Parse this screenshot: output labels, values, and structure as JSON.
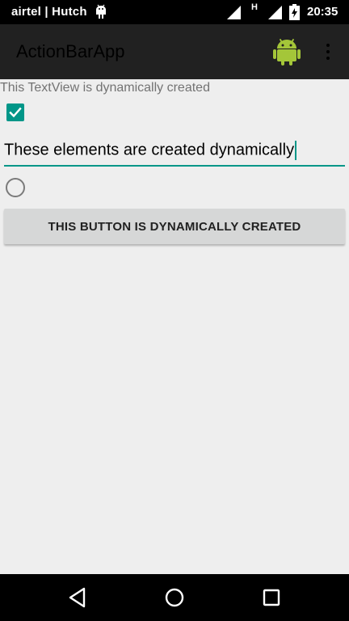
{
  "status_bar": {
    "carrier": "airtel | Hutch",
    "network_type": "H",
    "time": "20:35",
    "icons": [
      "android-notification-icon",
      "signal-icon",
      "signal-icon",
      "battery-charging-icon"
    ]
  },
  "action_bar": {
    "title": "ActionBarApp",
    "icons": [
      "android-icon",
      "overflow-menu-icon"
    ],
    "android_color": "#a4c639"
  },
  "content": {
    "textview": "This TextView is dynamically created",
    "checkbox_checked": true,
    "edittext_value": "These elements are created dynamically",
    "radio_checked": false,
    "button_label": "THIS BUTTON IS DYNAMICALLY CREATED"
  },
  "nav_bar": {
    "icons": [
      "back-icon",
      "home-icon",
      "recents-icon"
    ]
  },
  "colors": {
    "accent": "#009688",
    "background": "#eeeeee",
    "action_bar": "#212121"
  }
}
